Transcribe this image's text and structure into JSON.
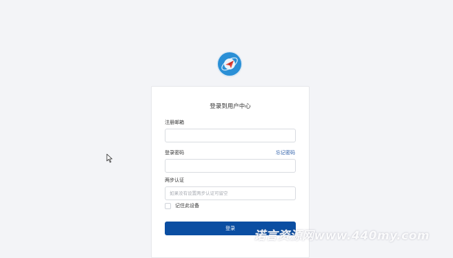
{
  "login": {
    "title": "登录到用户中心",
    "email_label": "注册邮箱",
    "email_value": "",
    "password_label": "登录密码",
    "forgot_password": "忘记密码",
    "password_value": "",
    "twofa_label": "两步认证",
    "twofa_placeholder": "如果没有设置两步认证可留空",
    "remember_label": "记住此设备",
    "submit_label": "登录"
  },
  "watermark_text": "诺言资源网www.440my.com",
  "colors": {
    "background": "#f3f4f7",
    "primary_button": "#0b4ea2",
    "link": "#2c5ea8",
    "logo": "#2a8fd6"
  },
  "icons": {
    "logo": "paper-plane-logo-icon",
    "cursor": "mouse-pointer-icon"
  }
}
